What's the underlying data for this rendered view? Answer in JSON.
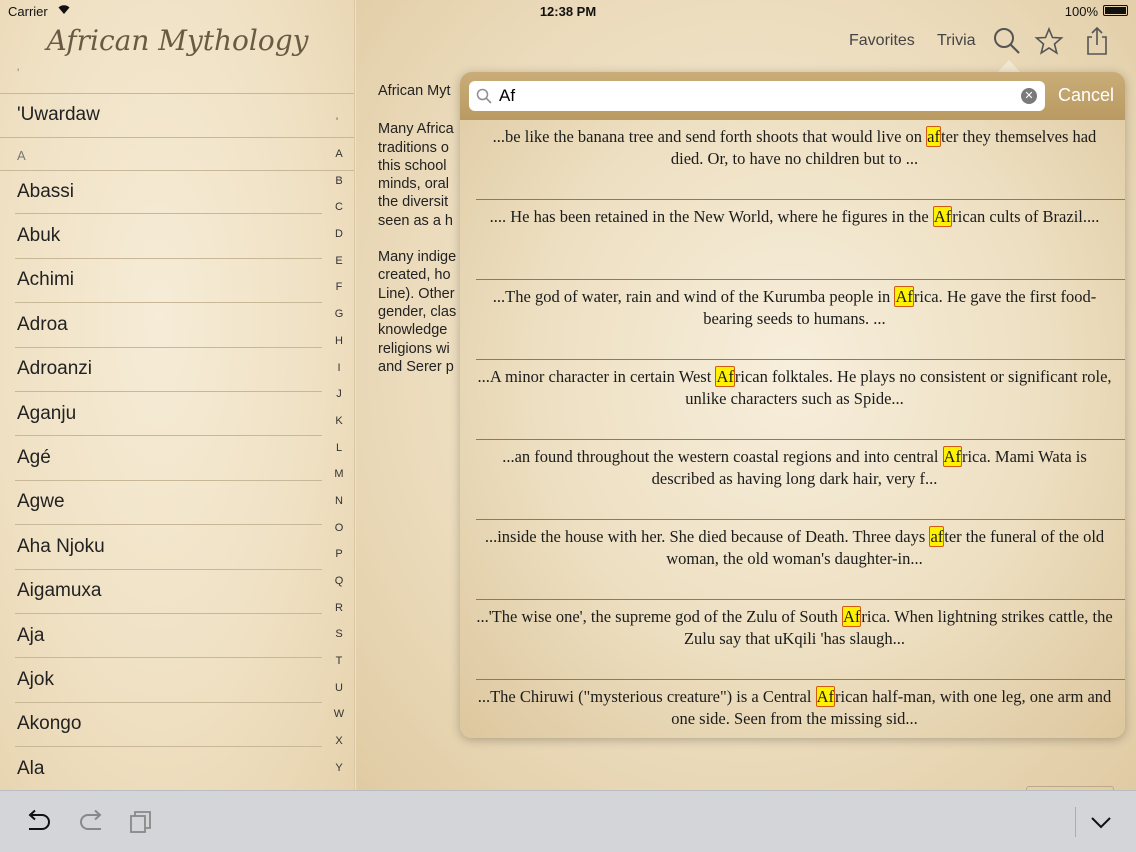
{
  "status_bar": {
    "carrier": "Carrier",
    "time": "12:38 PM",
    "battery": "100%"
  },
  "sidebar": {
    "title": "African Mythology",
    "apostrophe_header": "'",
    "first_item": "'Uwardaw",
    "first_item_index": "'",
    "section_header": "A",
    "items": [
      "Abassi",
      "Abuk",
      "Achimi",
      "Adroa",
      "Adroanzi",
      "Aganju",
      "Agé",
      "Agwe",
      "Aha Njoku",
      "Aigamuxa",
      "Aja",
      "Ajok",
      "Akongo",
      "Ala"
    ],
    "index": [
      "A",
      "B",
      "C",
      "D",
      "E",
      "F",
      "G",
      "H",
      "I",
      "J",
      "K",
      "L",
      "M",
      "N",
      "O",
      "P",
      "Q",
      "R",
      "S",
      "T",
      "U",
      "W",
      "X",
      "Y"
    ]
  },
  "navbar": {
    "favorites_label": "Favorites",
    "trivia_label": "Trivia",
    "icons": [
      "search-icon",
      "star-icon",
      "share-icon"
    ]
  },
  "article": {
    "title": "African Myt",
    "paragraph1": [
      "Many Africa",
      "traditions o",
      "this school",
      "minds, oral",
      "the diversit",
      "seen as a h"
    ],
    "paragraph2": [
      "Many indige",
      "created, ho",
      "Line). Other",
      "gender, clas",
      "knowledge",
      "religions wi",
      "and Serer p"
    ]
  },
  "search": {
    "query": "Af",
    "placeholder": "",
    "cancel_label": "Cancel",
    "highlight_color": "#fff200",
    "results": [
      {
        "before": "...be like the banana tree and send forth shoots that would live on ",
        "match": "af",
        "after": "ter they themselves had died. Or, to have no children but to ..."
      },
      {
        "before": ".... He has been retained in the New World, where he figures in the ",
        "match": "Af",
        "after": "rican cults of Brazil...."
      },
      {
        "before": "...The god of water, rain and wind of the Kurumba people in ",
        "match": "Af",
        "after": "rica. He gave the first food-bearing seeds to humans. ..."
      },
      {
        "before": "...A minor character in certain West ",
        "match": "Af",
        "after": "rican folktales. He plays no consistent or significant role, unlike characters such as Spide..."
      },
      {
        "before": "...an found throughout the western coastal regions and into central ",
        "match": "Af",
        "after": "rica. Mami Wata is described as having long dark hair, very f..."
      },
      {
        "before": "...inside the house with her. She died because of Death. Three days ",
        "match": "af",
        "after": "ter the funeral of the old woman, the old woman's daughter-in..."
      },
      {
        "before": "...'The wise one', the supreme god of the Zulu of South ",
        "match": "Af",
        "after": "rica. When lightning strikes cattle, the Zulu say that uKqili 'has slaugh..."
      },
      {
        "before": "...The Chiruwi (\"mysterious creature\") is a Central ",
        "match": "Af",
        "after": "rican half-man, with one leg, one arm and one side. Seen from the missing sid..."
      }
    ]
  },
  "toolbar": {
    "icons": [
      "undo-icon",
      "redo-icon",
      "copy-icon",
      "chevron-down-icon"
    ]
  }
}
